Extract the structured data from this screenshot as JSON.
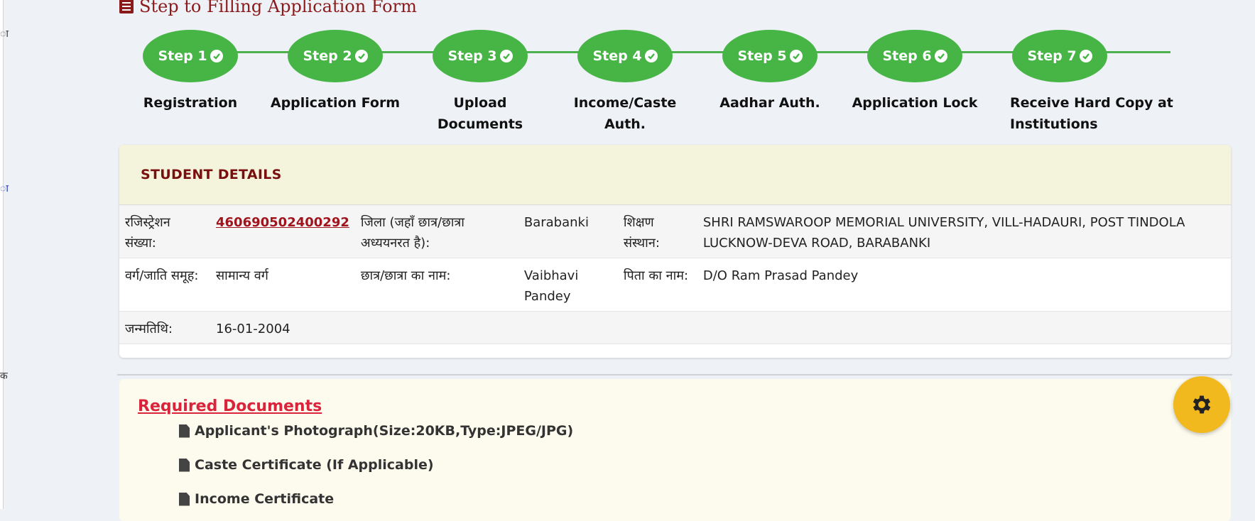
{
  "rail": {
    "glyphs": [
      "ा",
      "ा",
      "क"
    ]
  },
  "header": {
    "title": "Step to Filling Application Form"
  },
  "steps": [
    {
      "pill": "Step 1",
      "label": "Registration"
    },
    {
      "pill": "Step 2",
      "label": "Application Form"
    },
    {
      "pill": "Step 3",
      "label": "Upload Documents"
    },
    {
      "pill": "Step 4",
      "label": "Income/Caste Auth."
    },
    {
      "pill": "Step 5",
      "label": "Aadhar Auth."
    },
    {
      "pill": "Step 6",
      "label": "Application Lock"
    },
    {
      "pill": "Step 7",
      "label": "Receive Hard Copy at Institutions"
    }
  ],
  "student": {
    "title": "STUDENT DETAILS",
    "reg_label": "रजिस्ट्रेशन संख्या:",
    "reg_value": "460690502400292",
    "district_label": "जिला (जहाँ छात्र/छात्रा अध्ययनरत है):",
    "district_value": "Barabanki",
    "institution_label": "शिक्षण संस्थान:",
    "institution_value": "SHRI RAMSWAROOP MEMORIAL UNIVERSITY, VILL-HADAURI, POST TINDOLA LUCKNOW-DEVA ROAD, BARABANKI",
    "category_label": "वर्ग/जाति समूह:",
    "category_value": "सामान्य वर्ग",
    "name_label": "छात्र/छात्रा का नाम:",
    "name_value": "Vaibhavi Pandey",
    "father_label": "पिता का नाम:",
    "father_value": "D/O Ram Prasad Pandey",
    "dob_label": "जन्मतिथि:",
    "dob_value": "16-01-2004"
  },
  "documents": {
    "title": "Required Documents",
    "items": [
      "Applicant's Photograph(Size:20KB,Type:JPEG/JPG)",
      "Caste Certificate (If Applicable)",
      "Income Certificate"
    ]
  },
  "colors": {
    "step_green": "#46b546",
    "title_maroon": "#8b1a1a",
    "link_red": "#a0141e",
    "gear_yellow": "#f2b91f"
  }
}
